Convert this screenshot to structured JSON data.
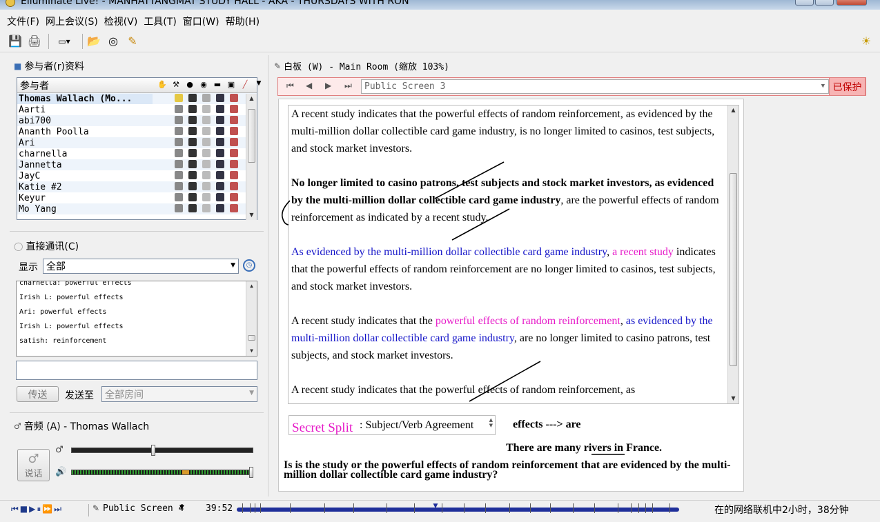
{
  "window": {
    "title": "Elluminate Live! - MANHATTANGMAT STUDY HALL - AKA - THURSDAYS WITH RON"
  },
  "menu": [
    "文件(F)",
    "网上会议(S)",
    "检视(V)",
    "工具(T)",
    "窗口(W)",
    "帮助(H)"
  ],
  "participants": {
    "title": "参与者(r)资料",
    "header": "参与者",
    "rows": [
      "Thomas Wallach (Mo...",
      "Aarti",
      "abi700",
      "Ananth Poolla",
      "Ari",
      "charnella",
      "Jannetta",
      "JayC",
      "Katie #2",
      "Keyur",
      "Mo Yang"
    ]
  },
  "chat": {
    "title": "直接通讯(C)",
    "display_label": "显示",
    "filter_value": "全部",
    "messages": [
      "charnella: powerful effects",
      "Irish L: powerful effects",
      "Ari: powerful effects",
      "Irish L: powerful effects",
      "satish: reinforcement"
    ],
    "send_label": "传送",
    "send_to_label": "发送至",
    "send_to_value": "全部房间"
  },
  "audio": {
    "title": "音频 (A) - Thomas Wallach",
    "talk_label": "说话",
    "mic_level": 0.45,
    "speaker_level": 1.0
  },
  "whiteboard": {
    "title": "白板 (W) - Main Room (缩放 103%)",
    "screen": "Public Screen 3",
    "protected_label": "已保护",
    "p1": "A recent study indicates that the powerful effects of random reinforcement, as evidenced by the multi-million dollar collectible card game industry, is no longer limited to casinos, test subjects, and stock market investors.",
    "p2_bold": "No longer limited to casino patrons, test subjects and stock market investors, as evidenced by the multi-million dollar collectible card game industry",
    "p2_rest": ", are the powerful effects of random reinforcement as indicated by a recent study.",
    "p3_blue": "As evidenced by the multi-million dollar collectible card game industry",
    "p3_comma": ", ",
    "p3_pink": "a recent study",
    "p3_rest": " indicates that the powerful effects of random reinforcement are no longer limited to casinos, test subjects, and stock market investors.",
    "p4_a": "A recent study indicates that the ",
    "p4_pink": "powerful effects of random reinforcement",
    "p4_comma": ", ",
    "p4_blue": "as evidenced by the multi-million dollar collectible card game industry",
    "p4_rest": ", are no longer limited to casino patrons, test subjects, and stock market investors.",
    "p5": "A recent study indicates that the powerful effects of random reinforcement, as",
    "secret_split": "Secret Split",
    "split_topic": ": Subject/Verb Agreement",
    "note_effects": "effects ---> are",
    "note_rivers_a": "There are many ",
    "note_rivers_u": "rivers",
    "note_rivers_b": " in France.",
    "question": "Is is the study or the powerful effects of random reinforcement that are evidenced by the multi-million dollar collectible card game industry?"
  },
  "statusbar": {
    "screen": "Public Screen 4",
    "time": "39:52",
    "online": "在的网络联机中2小时，38分钟",
    "progress": 0.45
  },
  "colors": {
    "blue": "#1414c8",
    "pink": "#e619c8",
    "protected": "#c00000"
  }
}
